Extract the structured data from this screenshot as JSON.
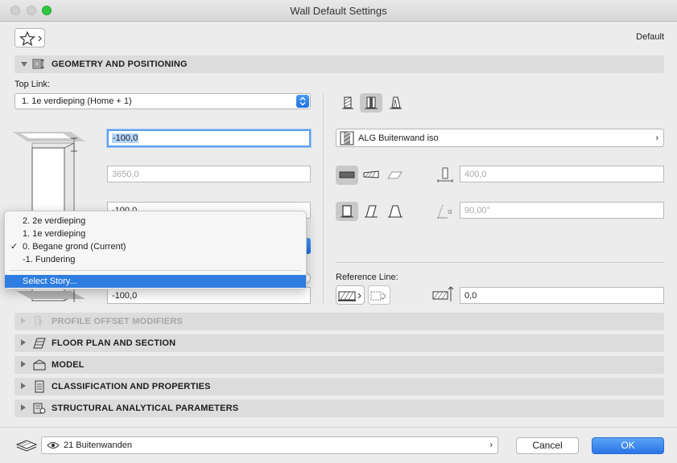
{
  "window": {
    "title": "Wall Default Settings"
  },
  "header": {
    "default_label": "Default"
  },
  "sections": {
    "geometry": "GEOMETRY AND POSITIONING",
    "profile": "PROFILE OFFSET MODIFIERS",
    "floorplan": "FLOOR PLAN AND SECTION",
    "model": "MODEL",
    "classification": "CLASSIFICATION AND PROPERTIES",
    "structural": "STRUCTURAL ANALYTICAL PARAMETERS"
  },
  "geometry": {
    "top_link_label": "Top Link:",
    "top_link_value": "1. 1e verdieping (Home + 1)",
    "top_offset": "-100,0",
    "height": "3650,0",
    "bottom_offset_partial": "-100,0",
    "base_offset": "-100,0",
    "building_material": "ALG Buitenwand iso",
    "thickness": "400,0",
    "angle": "90,00°",
    "reference_line_label": "Reference Line:",
    "reference_offset": "0,0"
  },
  "story_menu": {
    "items": [
      {
        "label": "2. 2e verdieping",
        "checked": false
      },
      {
        "label": "1. 1e verdieping",
        "checked": false
      },
      {
        "label": "0. Begane grond (Current)",
        "checked": true
      },
      {
        "label": "-1. Fundering",
        "checked": false
      }
    ],
    "select_story": "Select Story...",
    "checkmark": "✓"
  },
  "footer": {
    "layer": "21 Buitenwanden",
    "cancel_label": "Cancel",
    "ok_label": "OK"
  },
  "colors": {
    "accent": "#2f7de1",
    "ok_button": "#2a75e6"
  }
}
